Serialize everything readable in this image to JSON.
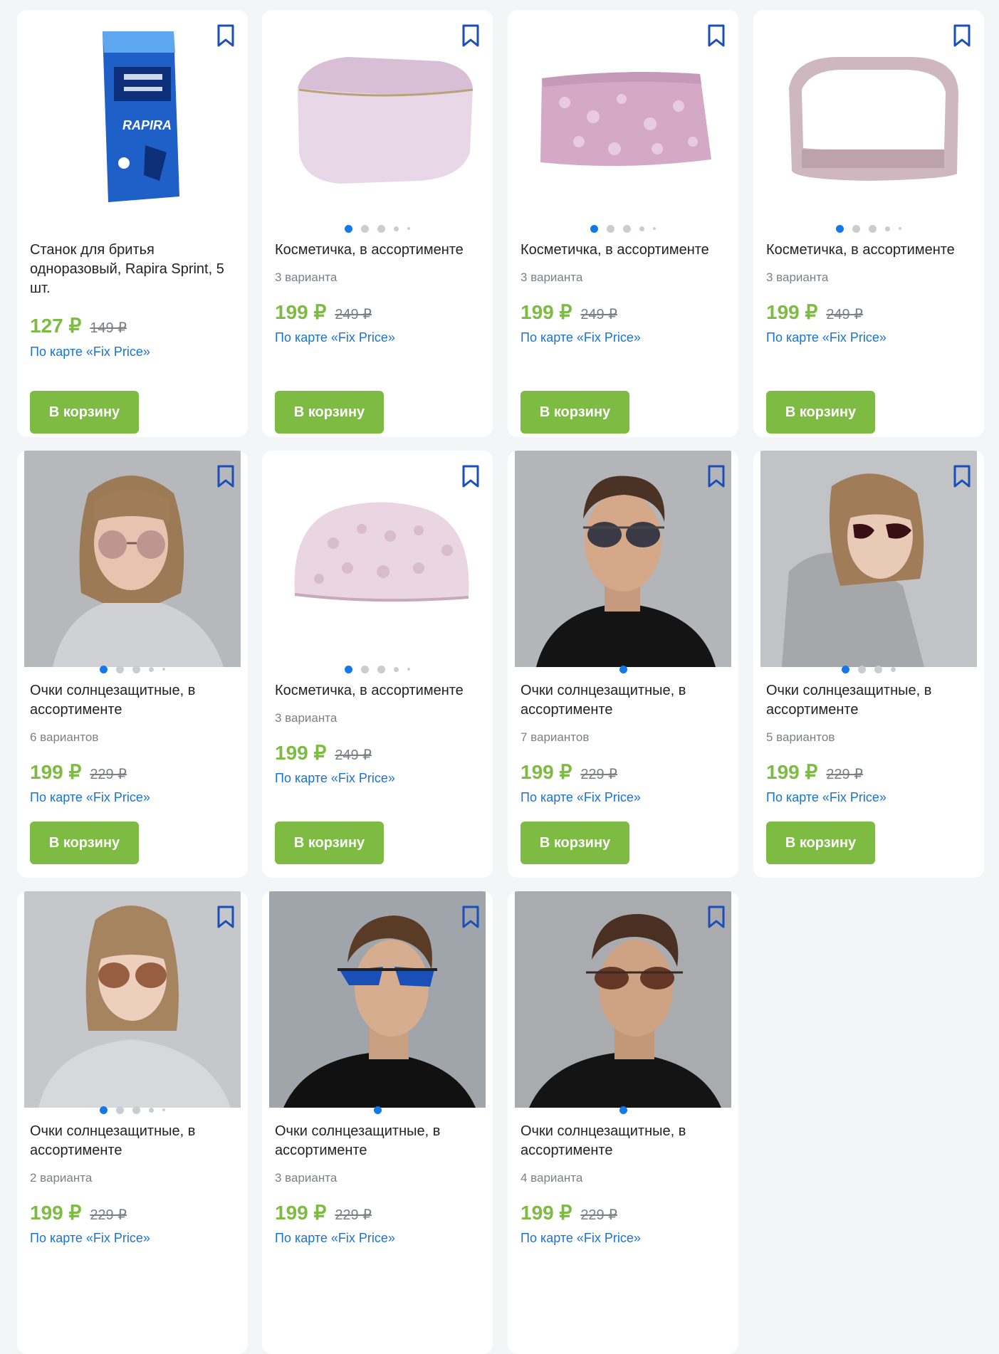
{
  "products": [
    {
      "title": "Станок для бритья одноразовый, Rapira Sprint, 5 шт.",
      "variants": "",
      "price": "127 ₽",
      "old_price": "149 ₽",
      "card_note": "По карте «Fix Price»",
      "button": "В корзину"
    },
    {
      "title": "Косметичка, в ассортименте",
      "variants": "3 варианта",
      "price": "199 ₽",
      "old_price": "249 ₽",
      "card_note": "По карте «Fix Price»",
      "button": "В корзину"
    },
    {
      "title": "Косметичка, в ассортименте",
      "variants": "3 варианта",
      "price": "199 ₽",
      "old_price": "249 ₽",
      "card_note": "По карте «Fix Price»",
      "button": "В корзину"
    },
    {
      "title": "Косметичка, в ассортименте",
      "variants": "3 варианта",
      "price": "199 ₽",
      "old_price": "249 ₽",
      "card_note": "По карте «Fix Price»",
      "button": "В корзину"
    },
    {
      "title": "Очки солнцезащитные, в ассортименте",
      "variants": "6 вариантов",
      "price": "199 ₽",
      "old_price": "229 ₽",
      "card_note": "По карте «Fix Price»",
      "button": "В корзину"
    },
    {
      "title": "Косметичка, в ассортименте",
      "variants": "3 варианта",
      "price": "199 ₽",
      "old_price": "249 ₽",
      "card_note": "По карте «Fix Price»",
      "button": "В корзину"
    },
    {
      "title": "Очки солнцезащитные, в ассортименте",
      "variants": "7 вариантов",
      "price": "199 ₽",
      "old_price": "229 ₽",
      "card_note": "По карте «Fix Price»",
      "button": "В корзину"
    },
    {
      "title": "Очки солнцезащитные, в ассортименте",
      "variants": "5 вариантов",
      "price": "199 ₽",
      "old_price": "229 ₽",
      "card_note": "По карте «Fix Price»",
      "button": "В корзину"
    },
    {
      "title": "Очки солнцезащитные, в ассортименте",
      "variants": "2 варианта",
      "price": "199 ₽",
      "old_price": "229 ₽",
      "card_note": "По карте «Fix Price»",
      "button": ""
    },
    {
      "title": "Очки солнцезащитные, в ассортименте",
      "variants": "3 варианта",
      "price": "199 ₽",
      "old_price": "229 ₽",
      "card_note": "По карте «Fix Price»",
      "button": ""
    },
    {
      "title": "Очки солнцезащитные, в ассортименте",
      "variants": "4 варианта",
      "price": "199 ₽",
      "old_price": "229 ₽",
      "card_note": "По карте «Fix Price»",
      "button": ""
    }
  ],
  "icons": {
    "bookmark": "bookmark-icon"
  },
  "colors": {
    "price_green": "#7dbb42",
    "link_blue": "#1a72d6",
    "accent_blue": "#1478e8",
    "button_green": "#7dbb42"
  }
}
